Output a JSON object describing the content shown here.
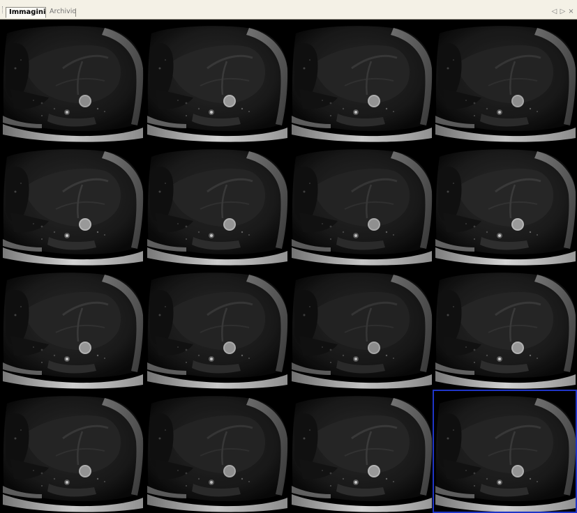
{
  "tabs": [
    {
      "label": "Immagini",
      "active": true
    },
    {
      "label": "Archivio",
      "active": false
    }
  ],
  "controls": {
    "prev": "◁",
    "next": "▷",
    "close": "×"
  },
  "viewer": {
    "rows": 4,
    "columns": 4,
    "image_count": 16,
    "selected_index": 15,
    "selection_color": "#1f35c8",
    "images": [
      {
        "index": 1
      },
      {
        "index": 2
      },
      {
        "index": 3
      },
      {
        "index": 4
      },
      {
        "index": 5
      },
      {
        "index": 6
      },
      {
        "index": 7
      },
      {
        "index": 8
      },
      {
        "index": 9
      },
      {
        "index": 10
      },
      {
        "index": 11
      },
      {
        "index": 12
      },
      {
        "index": 13
      },
      {
        "index": 14
      },
      {
        "index": 15
      },
      {
        "index": 16
      }
    ]
  }
}
